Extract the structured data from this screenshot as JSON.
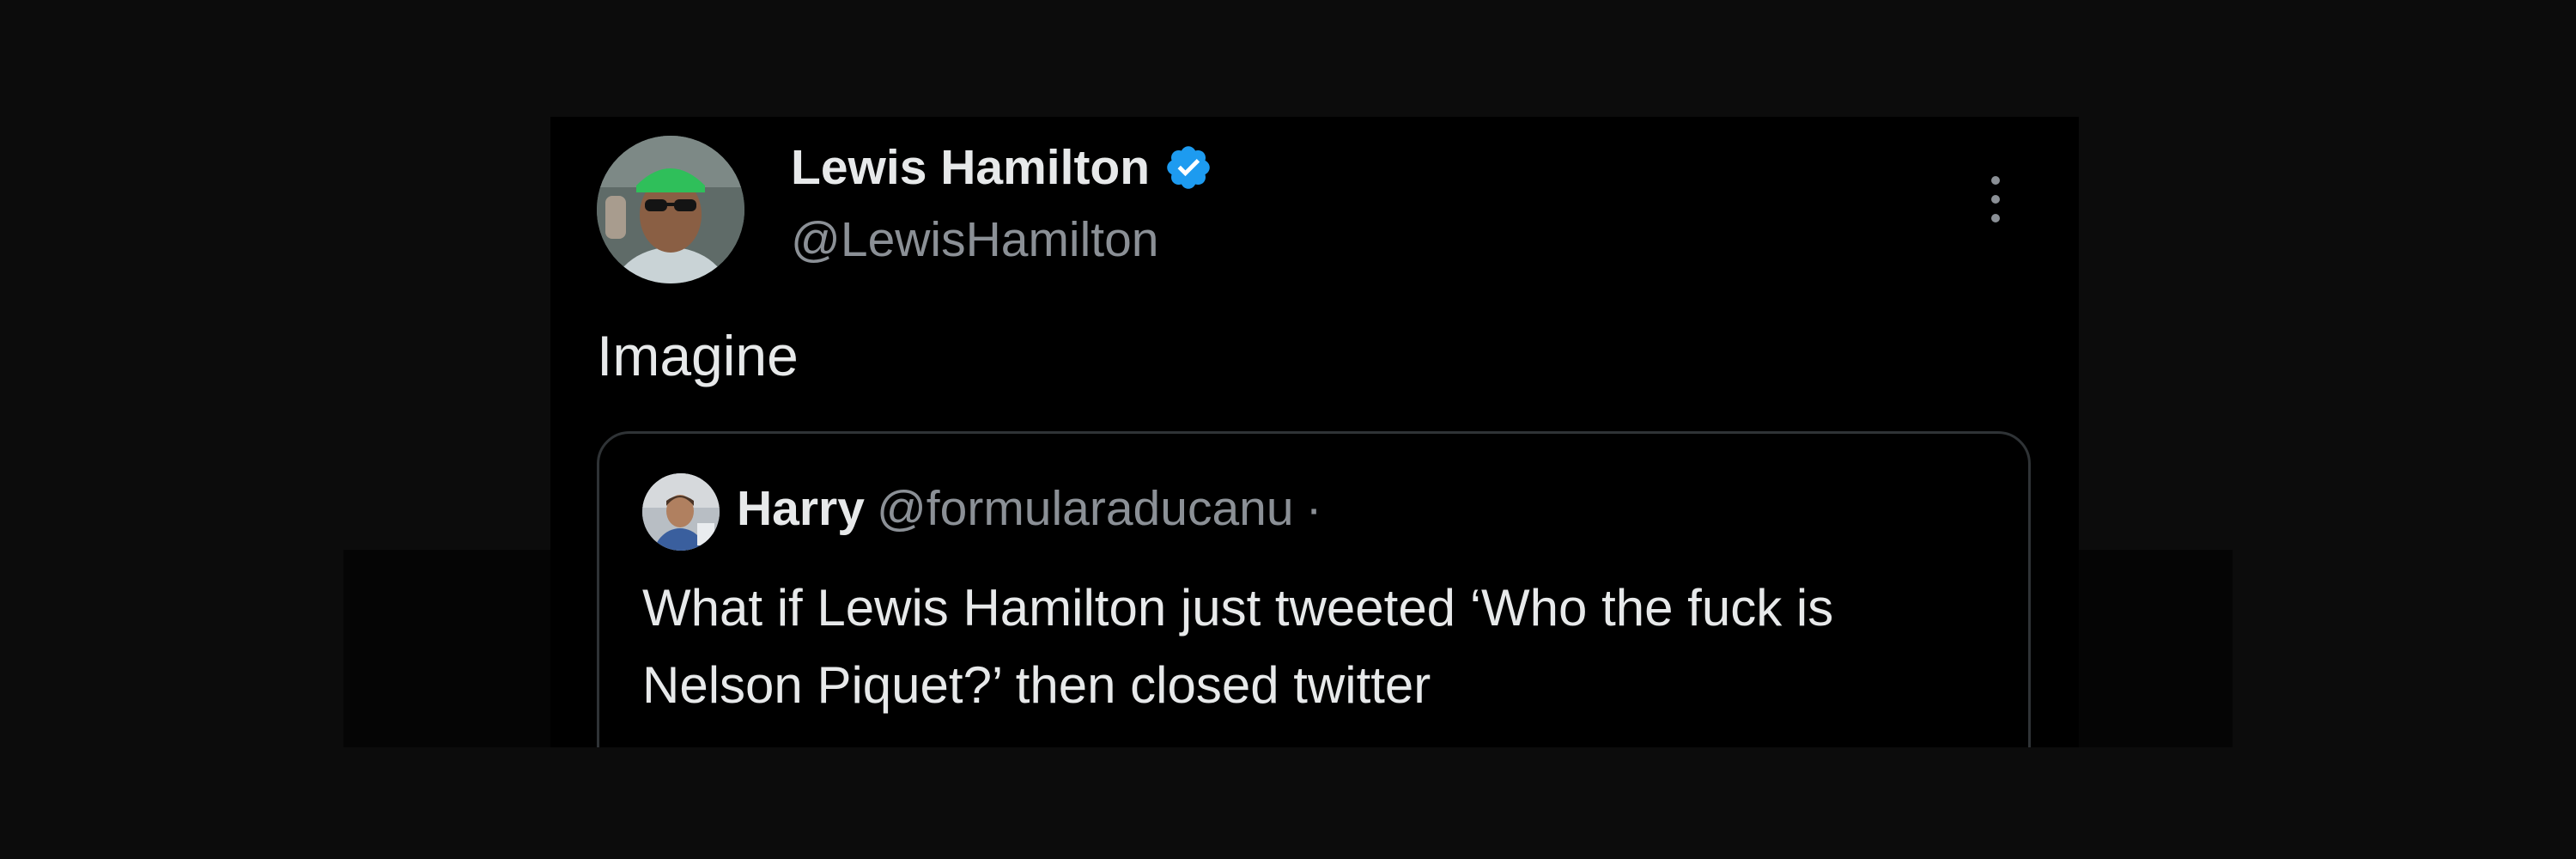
{
  "colors": {
    "page_background": "#0c0c0c",
    "card_background": "#000000",
    "primary_text": "#e7e9ea",
    "secondary_text": "#8b9096",
    "verified_blue": "#1d9bf0",
    "quote_border": "#2f3336"
  },
  "tweet": {
    "author": {
      "name": "Lewis Hamilton",
      "handle": "@LewisHamilton",
      "verified": true,
      "avatar_icon": "profile-photo",
      "badge_icon": "verified-badge-icon"
    },
    "menu_icon": "more-options-icon",
    "text": "Imagine",
    "quoted_tweet": {
      "author": {
        "name": "Harry",
        "handle": "@formularaducanu",
        "avatar_icon": "profile-photo"
      },
      "separator": "·",
      "text": "What if Lewis Hamilton just tweeted ‘Who the fuck is Nelson Piquet?’ then closed twitter"
    }
  }
}
